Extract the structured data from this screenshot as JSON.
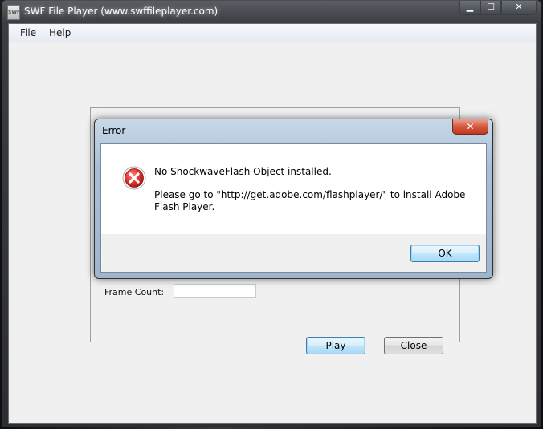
{
  "window": {
    "title": "SWF File Player (www.swffileplayer.com)",
    "app_icon_text": "SWF",
    "minimize": "▁",
    "maximize": "☐",
    "close": "✕"
  },
  "menu": {
    "items": [
      {
        "label": "File"
      },
      {
        "label": "Help"
      }
    ]
  },
  "form": {
    "frame_count_label": "Frame Count:",
    "frame_count_value": "",
    "play_label": "Play",
    "close_label": "Close"
  },
  "dialog": {
    "title": "Error",
    "close_glyph": "✕",
    "message_line1": "No ShockwaveFlash Object installed.",
    "message_line2": "Please go to \"http://get.adobe.com/flashplayer/\" to install Adobe Flash Player.",
    "ok_label": "OK",
    "icon": "error-icon"
  },
  "colors": {
    "error_red": "#d32f2f",
    "dialog_frame": "#a9bfd6",
    "default_button_border": "#3c7fb1"
  }
}
